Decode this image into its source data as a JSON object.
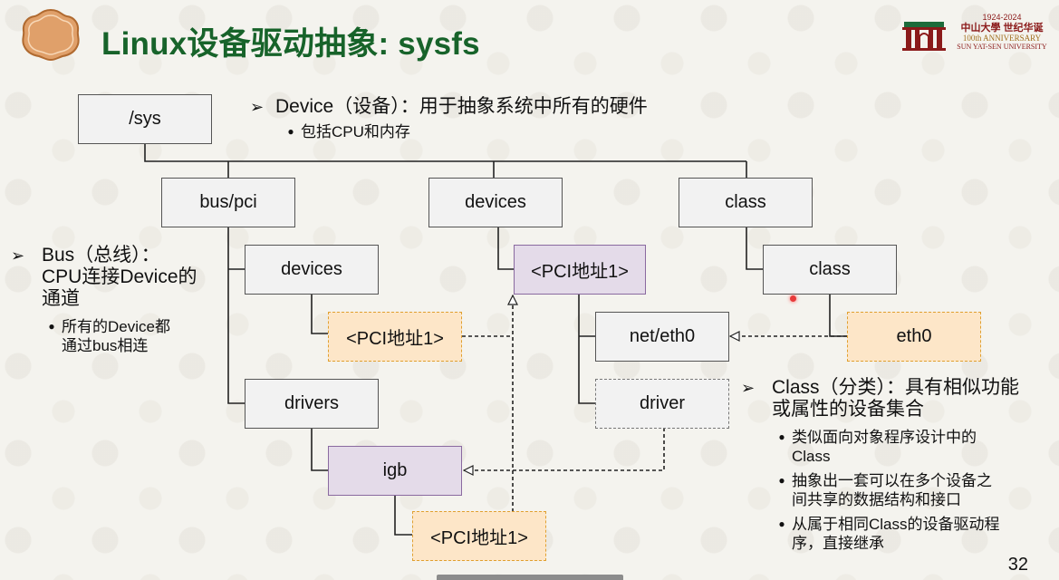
{
  "slide": {
    "title": "Linux设备驱动抽象: sysfs",
    "page_number": "32"
  },
  "logo": {
    "years": "1924-2024",
    "name": "中山大學 世纪华诞",
    "anniversary": "100th ANNIVERSARY",
    "university": "SUN YAT-SEN UNIVERSITY"
  },
  "diagram": {
    "sys": "/sys",
    "bus_pci": "bus/pci",
    "devices_top": "devices",
    "class_top": "class",
    "bus_devices": "devices",
    "pci_addr_top": "<PCI地址1>",
    "class_sub": "class",
    "pci_addr_bus": "<PCI地址1>",
    "net_eth0": "net/eth0",
    "eth0": "eth0",
    "drivers": "drivers",
    "driver": "driver",
    "igb": "igb",
    "pci_addr_igb": "<PCI地址1>"
  },
  "notes": {
    "device_head": "Device（设备）：用于抽象系统中所有的硬件",
    "device_sub": "包括CPU和内存",
    "bus_head_1": "Bus（总线）：",
    "bus_head_2": "CPU连接Device的",
    "bus_head_3": "通道",
    "bus_sub_1": "所有的Device都",
    "bus_sub_2": "通过bus相连",
    "class_head_1": "Class（分类）：具有相似功能",
    "class_head_2": "或属性的设备集合",
    "class_subs": [
      [
        "类似面向对象程序设计中的",
        "Class"
      ],
      [
        "抽象出一套可以在多个设备之",
        "间共享的数据结构和接口"
      ],
      [
        "从属于相同Class的设备驱动程",
        "序，直接继承"
      ]
    ]
  },
  "colors": {
    "title": "#17632a",
    "purple_fill": "#e4dbe9",
    "orange_fill": "#fde6c8",
    "plain_fill": "#f2f2f2"
  }
}
